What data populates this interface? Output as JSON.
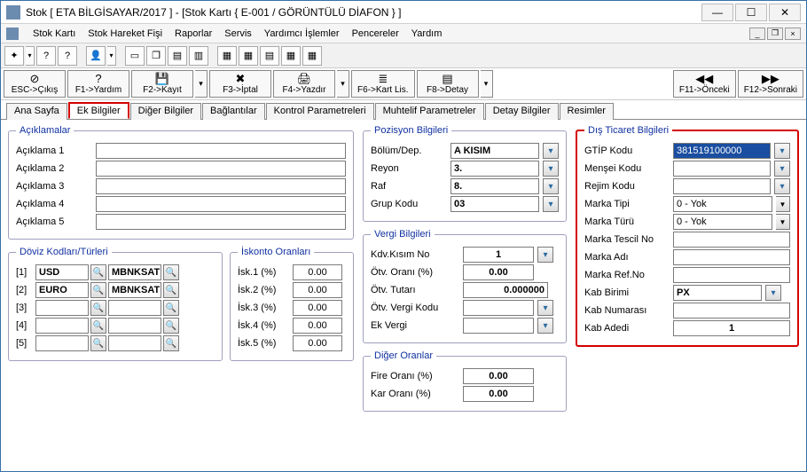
{
  "window": {
    "title": "Stok [ ETA BİLGİSAYAR/2017 ]  -  [Stok Kartı { E-001 / GÖRÜNTÜLÜ DİAFON } ]"
  },
  "menu": {
    "items": [
      "Stok Kartı",
      "Stok Hareket Fişi",
      "Raporlar",
      "Servis",
      "Yardımcı İşlemler",
      "Pencereler",
      "Yardım"
    ]
  },
  "fnbar": {
    "esc": "ESC->Çıkış",
    "f1": "F1->Yardım",
    "f2": "F2->Kayıt",
    "f3": "F3->İptal",
    "f4": "F4->Yazdır",
    "f6": "F6->Kart Lis.",
    "f8": "F8->Detay",
    "f11": "F11->Önceki",
    "f12": "F12->Sonraki"
  },
  "tabs": [
    "Ana Sayfa",
    "Ek Bilgiler",
    "Diğer Bilgiler",
    "Bağlantılar",
    "Kontrol Parametreleri",
    "Muhtelif Parametreler",
    "Detay Bilgiler",
    "Resimler"
  ],
  "active_tab": 1,
  "groups": {
    "aciklamalar": {
      "legend": "Açıklamalar",
      "labels": [
        "Açıklama 1",
        "Açıklama 2",
        "Açıklama 3",
        "Açıklama 4",
        "Açıklama 5"
      ],
      "values": [
        "",
        "",
        "",
        "",
        ""
      ]
    },
    "doviz": {
      "legend": "Döviz Kodları/Türleri",
      "rows": [
        {
          "idx": "[1]",
          "code": "USD",
          "type": "MBNKSAT"
        },
        {
          "idx": "[2]",
          "code": "EURO",
          "type": "MBNKSAT"
        },
        {
          "idx": "[3]",
          "code": "",
          "type": ""
        },
        {
          "idx": "[4]",
          "code": "",
          "type": ""
        },
        {
          "idx": "[5]",
          "code": "",
          "type": ""
        }
      ]
    },
    "iskonto": {
      "legend": "İskonto Oranları",
      "rows": [
        {
          "label": "İsk.1 (%)",
          "value": "0.00"
        },
        {
          "label": "İsk.2 (%)",
          "value": "0.00"
        },
        {
          "label": "İsk.3 (%)",
          "value": "0.00"
        },
        {
          "label": "İsk.4 (%)",
          "value": "0.00"
        },
        {
          "label": "İsk.5 (%)",
          "value": "0.00"
        }
      ]
    },
    "pozisyon": {
      "legend": "Pozisyon Bilgileri",
      "rows": [
        {
          "label": "Bölüm/Dep.",
          "value": "A KISIM"
        },
        {
          "label": "Reyon",
          "value": "3."
        },
        {
          "label": "Raf",
          "value": "8."
        },
        {
          "label": "Grup Kodu",
          "value": "03"
        }
      ]
    },
    "vergi": {
      "legend": "Vergi Bilgileri",
      "rows": [
        {
          "label": "Kdv.Kısım No",
          "value": "1",
          "type": "num"
        },
        {
          "label": "Ötv. Oranı (%)",
          "value": "0.00",
          "type": "val"
        },
        {
          "label": "Ötv. Tutarı",
          "value": "0.000000",
          "type": "wide"
        },
        {
          "label": "Ötv. Vergi Kodu",
          "value": "",
          "type": "lookup"
        },
        {
          "label": "Ek Vergi",
          "value": "",
          "type": "lookup"
        }
      ]
    },
    "diger": {
      "legend": "Diğer Oranlar",
      "rows": [
        {
          "label": "Fire Oranı (%)",
          "value": "0.00"
        },
        {
          "label": "Kar Oranı  (%)",
          "value": "0.00"
        }
      ]
    },
    "dis": {
      "legend": "Dış Ticaret Bilgileri",
      "rows": [
        {
          "label": "GTİP Kodu",
          "value": "381519100000",
          "selected": true,
          "lookup": true
        },
        {
          "label": "Menşei Kodu",
          "value": "",
          "lookup": true
        },
        {
          "label": "Rejim Kodu",
          "value": "",
          "lookup": true
        },
        {
          "label": "Marka Tipi",
          "value": "0 - Yok",
          "dropdown": true
        },
        {
          "label": "Marka Türü",
          "value": "0 - Yok",
          "dropdown": true
        },
        {
          "label": "Marka Tescil No",
          "value": ""
        },
        {
          "label": "Marka Adı",
          "value": ""
        },
        {
          "label": "Marka Ref.No",
          "value": ""
        },
        {
          "label": "Kab Birimi",
          "value": "PX",
          "lookup": true,
          "bold": true
        },
        {
          "label": "Kab Numarası",
          "value": ""
        },
        {
          "label": "Kab Adedi",
          "value": "1",
          "center": true,
          "bold": true
        }
      ]
    }
  }
}
